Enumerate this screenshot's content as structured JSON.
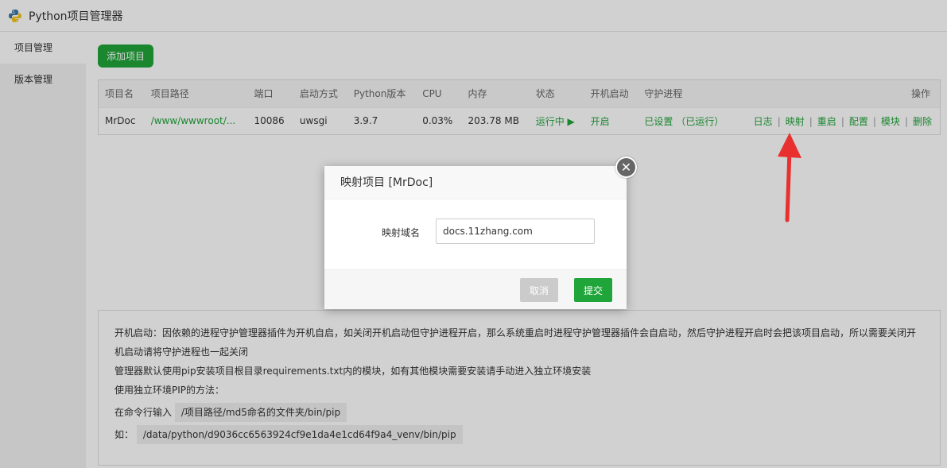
{
  "app": {
    "title": "Python项目管理器"
  },
  "sidebar": {
    "items": [
      {
        "label": "项目管理"
      },
      {
        "label": "版本管理"
      }
    ]
  },
  "toolbar": {
    "add_label": "添加项目"
  },
  "table": {
    "headers": [
      "项目名",
      "项目路径",
      "端口",
      "启动方式",
      "Python版本",
      "CPU",
      "内存",
      "状态",
      "开机启动",
      "守护进程",
      "操作"
    ],
    "rows": [
      {
        "name": "MrDoc",
        "path": "/www/wwwroot/...",
        "port": "10086",
        "start_mode": "uwsgi",
        "python_version": "3.9.7",
        "cpu": "0.03%",
        "memory": "203.78 MB",
        "status": "运行中 ▶",
        "autostart": "开启",
        "daemon": "已设置 （已运行）",
        "ops": [
          "日志",
          "映射",
          "重启",
          "配置",
          "模块",
          "删除"
        ]
      }
    ]
  },
  "info": {
    "line1": "开机启动：因依赖的进程守护管理器插件为开机自启，如关闭开机启动但守护进程开启，那么系统重启时进程守护管理器插件会自启动，然后守护进程开启时会把该项目启动，所以需要关闭开机启动请将守护进程也一起关闭",
    "line2": "管理器默认使用pip安装项目根目录requirements.txt内的模块，如有其他模块需要安装请手动进入独立环境安装",
    "line3": "使用独立环境PIP的方法：",
    "line4_prefix": "在命令行输入",
    "line4_code": "/项目路径/md5命名的文件夹/bin/pip",
    "line5_prefix": "如：",
    "line5_code": "/data/python/d9036cc6563924cf9e1da4e1cd64f9a4_venv/bin/pip"
  },
  "modal": {
    "title": "映射项目 [MrDoc]",
    "field_label": "映射域名",
    "field_value": "docs.11zhang.com",
    "cancel_label": "取消",
    "submit_label": "提交",
    "close_label": "✕"
  },
  "colors": {
    "accent": "#20a53a",
    "arrow": "#e8312f"
  }
}
